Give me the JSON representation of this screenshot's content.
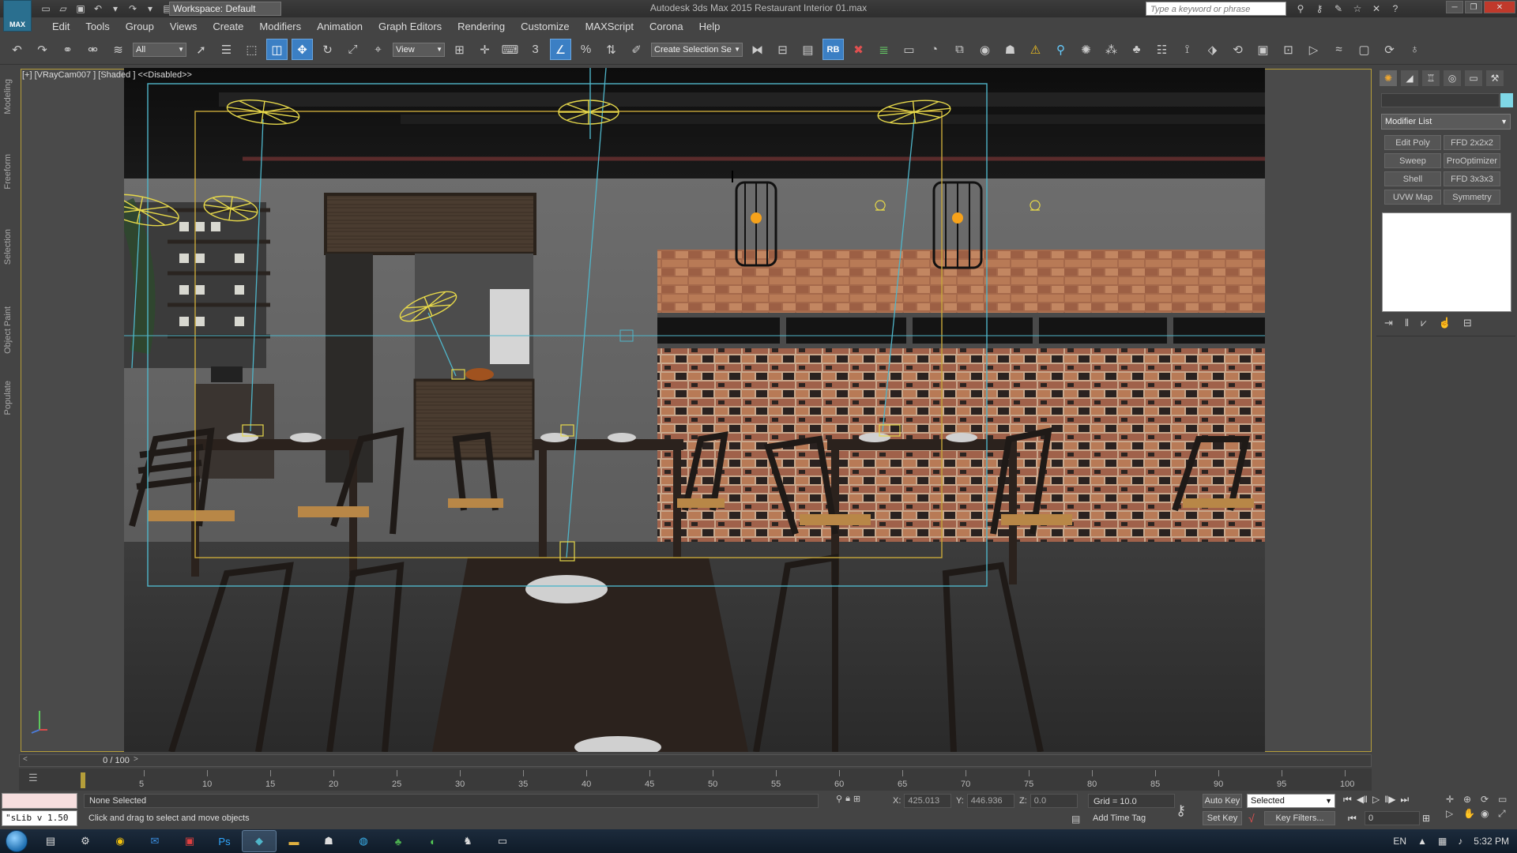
{
  "titlebar": {
    "app_title": "Autodesk 3ds Max  2015     Restaurant Interior 01.max",
    "workspace": "Workspace: Default",
    "search_placeholder": "Type a keyword or phrase",
    "logo_text": "MAX"
  },
  "menu": [
    "Edit",
    "Tools",
    "Group",
    "Views",
    "Create",
    "Modifiers",
    "Animation",
    "Graph Editors",
    "Rendering",
    "Customize",
    "MAXScript",
    "Corona",
    "Help"
  ],
  "toolbar": {
    "selection_filter": "All",
    "ref_coord": "View",
    "named_selection": "Create Selection Se",
    "angle_snap": "3",
    "rb_label": "RB"
  },
  "left_ribbon": [
    "Modeling",
    "Freeform",
    "Selection",
    "Object Paint",
    "Populate"
  ],
  "viewport": {
    "label": "[+] [VRayCam007 ] [Shaded ]  <<Disabled>>"
  },
  "command_panel": {
    "modifier_list": "Modifier List",
    "modifier_buttons": [
      "Edit Poly",
      "FFD 2x2x2",
      "Sweep",
      "ProOptimizer",
      "Shell",
      "FFD 3x3x3",
      "UVW Map",
      "Symmetry"
    ],
    "swatch_color": "#7fd7e6"
  },
  "timeline": {
    "frame_label": "0 / 100",
    "ticks": [
      "5",
      "10",
      "15",
      "20",
      "25",
      "30",
      "35",
      "40",
      "45",
      "50",
      "55",
      "60",
      "65",
      "70",
      "75",
      "80",
      "85",
      "90",
      "95",
      "100"
    ]
  },
  "status": {
    "selection": "None Selected",
    "prompt": "Click and drag to select and move objects",
    "maxscript_text": "\"sLib v 1.50",
    "x_label": "X:",
    "x_value": "425.013",
    "y_label": "Y:",
    "y_value": "446.936",
    "z_label": "Z:",
    "z_value": "0.0",
    "grid": "Grid = 10.0",
    "add_time_tag": "Add Time Tag",
    "auto_key": "Auto Key",
    "set_key": "Set Key",
    "selected_option": "Selected",
    "key_filters": "Key Filters...",
    "current_frame": "0"
  },
  "taskbar": {
    "language": "EN",
    "clock": "5:32 PM"
  },
  "colors": {
    "accent_active": "#3b7fc4",
    "viewport_border": "#b59e3a",
    "camera_frustum": "#4fb5c9",
    "safe_frame": "#c8a83a"
  }
}
